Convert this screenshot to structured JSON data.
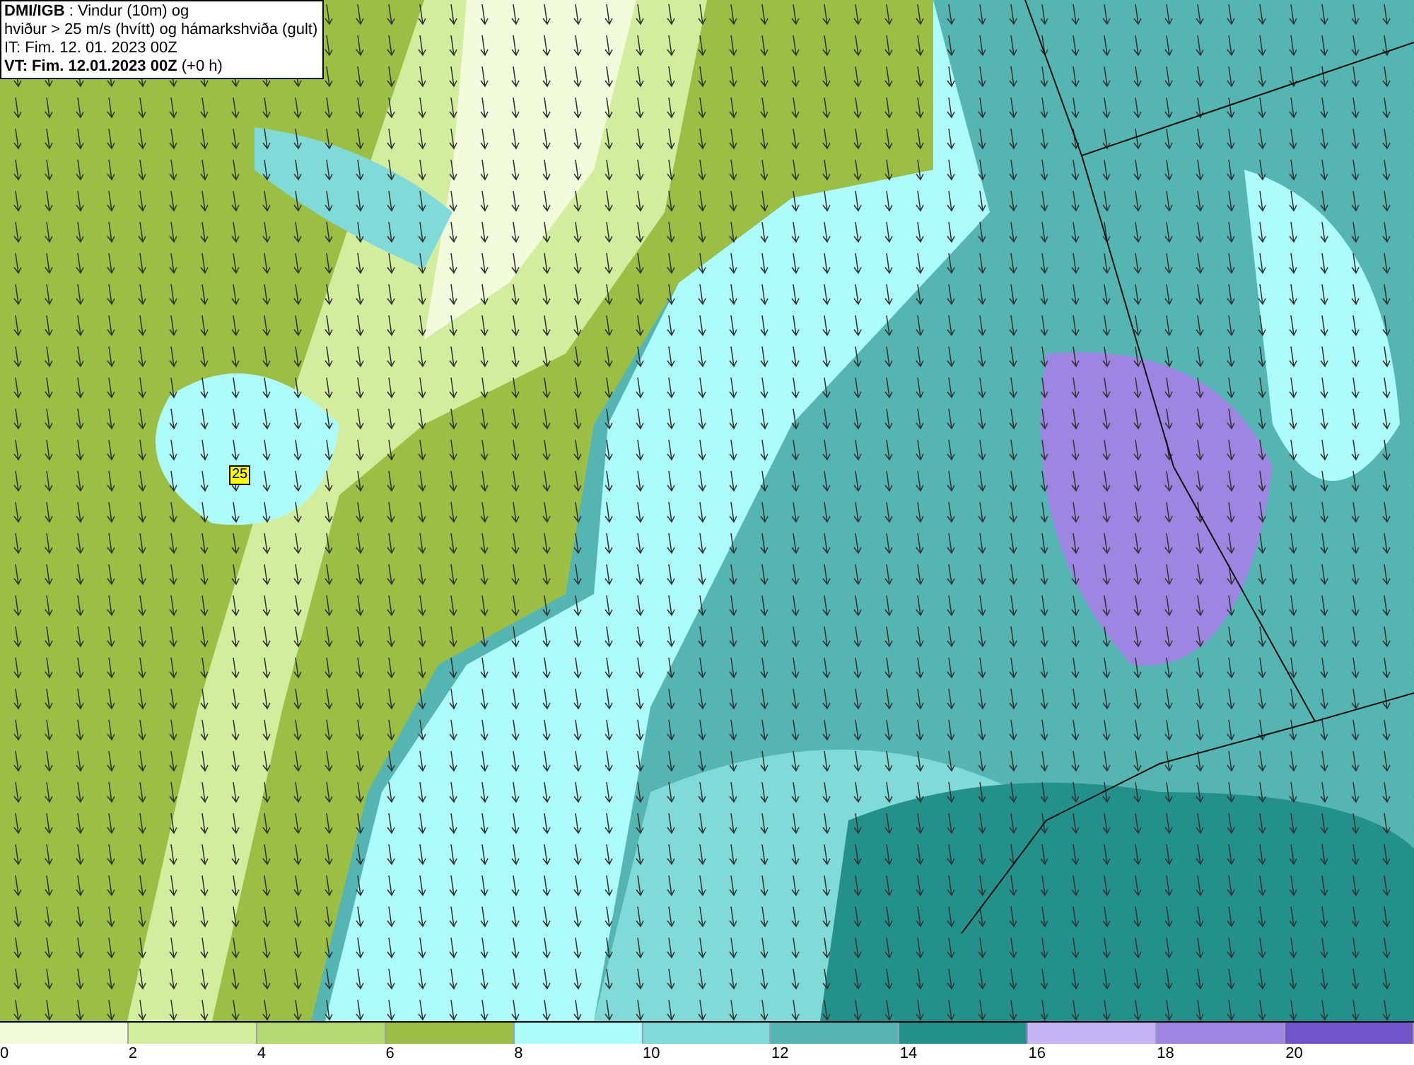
{
  "title_box": {
    "lines": [
      "**DMI/IGB** : Vindur (10m) og",
      "hviður > 25 m/s (hvítt) og hámarkshviða (gult)",
      "IT: Fim. 12. 01. 2023 00Z",
      "**VT: Fim. 12.01.2023 00Z** (+0 h)"
    ]
  },
  "map": {
    "gust_marker": {
      "label": "25",
      "color": "#ffff00"
    }
  },
  "legend": {
    "bins": [
      {
        "color": "#f2fbdc",
        "label": "0"
      },
      {
        "color": "#d3ed9f",
        "label": "2"
      },
      {
        "color": "#b4d874",
        "label": "4"
      },
      {
        "color": "#9bbf45",
        "label": "6"
      },
      {
        "color": "#aefbfb",
        "label": "8"
      },
      {
        "color": "#80dbd8",
        "label": "10"
      },
      {
        "color": "#55b5b3",
        "label": "12"
      },
      {
        "color": "#24908c",
        "label": "14"
      },
      {
        "color": "#c6b4f9",
        "label": "16"
      },
      {
        "color": "#9d85e2",
        "label": "18"
      },
      {
        "color": "#7254ca",
        "label": "20"
      }
    ]
  }
}
